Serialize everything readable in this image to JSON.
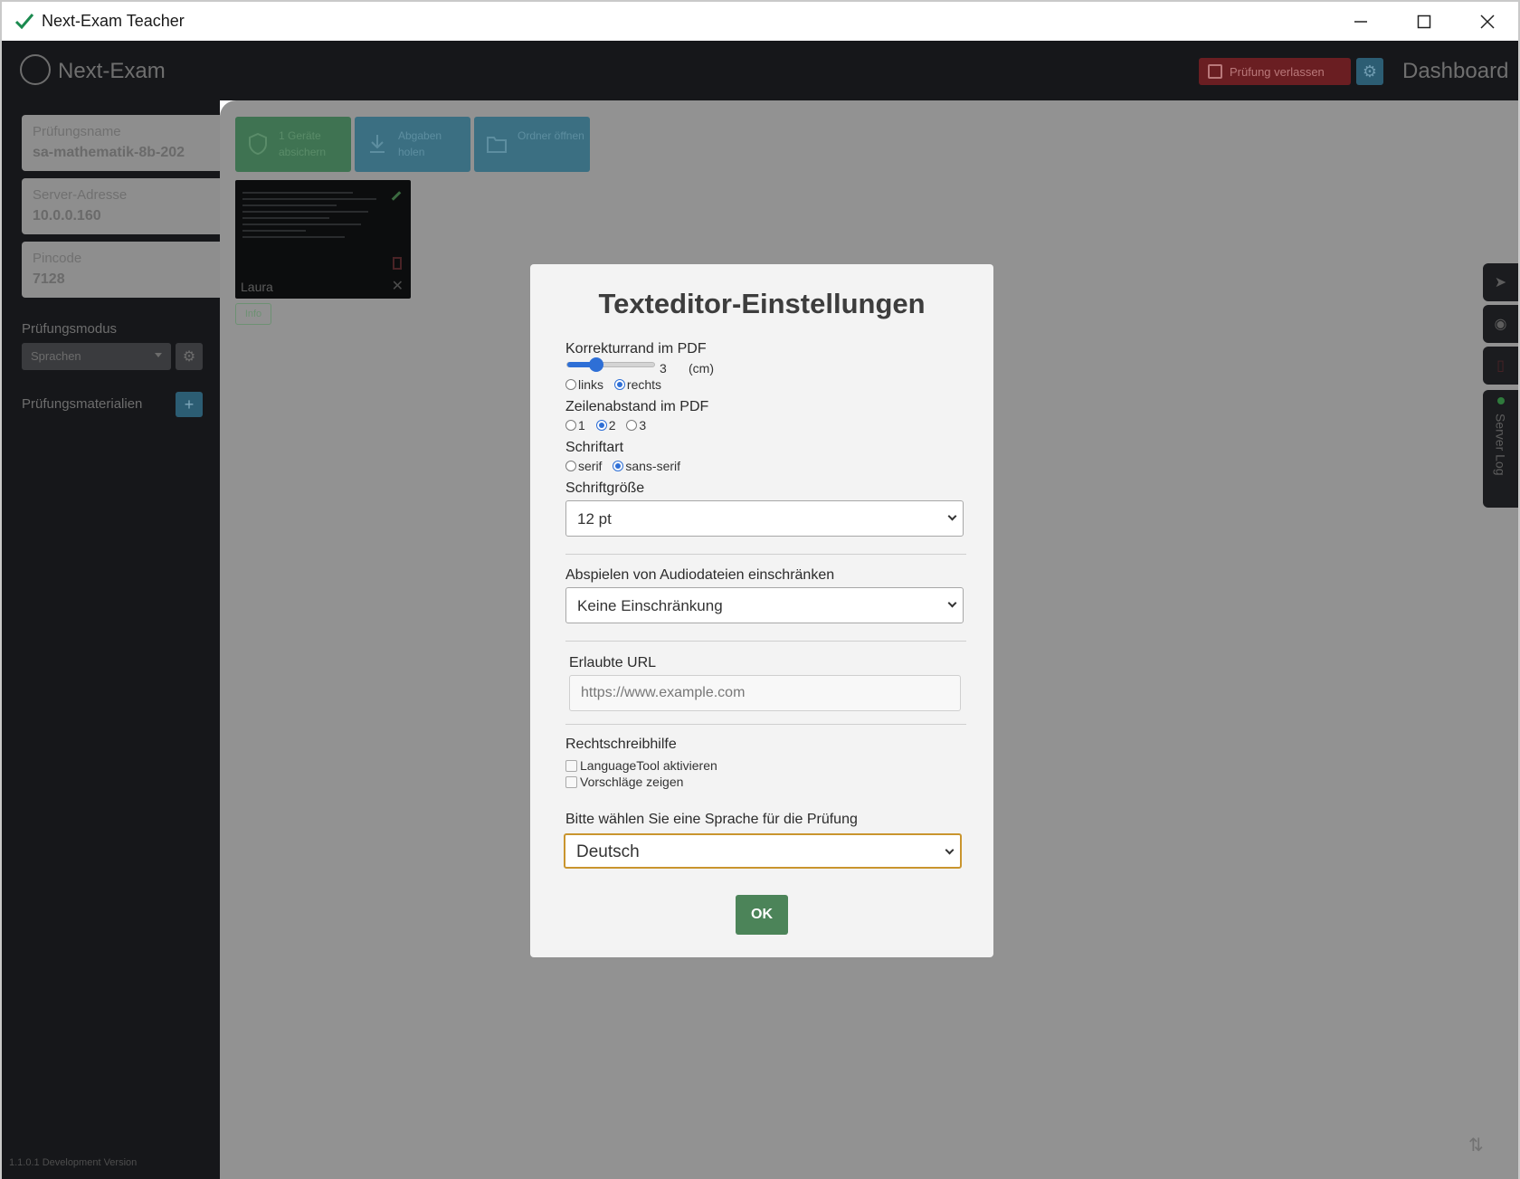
{
  "window": {
    "title": "Next-Exam Teacher"
  },
  "header": {
    "logo_text": "Next-Exam",
    "leave_button": "Prüfung verlassen",
    "dashboard_label": "Dashboard"
  },
  "sidebar": {
    "exam_name_label": "Prüfungsname",
    "exam_name_value": "sa-mathematik-8b-202",
    "server_label": "Server-Adresse",
    "server_value": "10.0.0.160",
    "pin_label": "Pincode",
    "pin_value": "7128",
    "mode_label": "Prüfungsmodus",
    "mode_value": "Sprachen",
    "materials_label": "Prüfungsmaterialien",
    "version": "1.1.0.1 Development Version"
  },
  "toolbar": {
    "lock_button": "1 Geräte absichern",
    "collect_button": "Abgaben holen",
    "folder_button": "Ordner öffnen"
  },
  "student": {
    "name": "Laura",
    "info_label": "Info"
  },
  "right_tabs": {
    "log_label": "Server Log"
  },
  "modal": {
    "title": "Texteditor-Einstellungen",
    "margin_label": "Korrekturrand im PDF",
    "margin_value": "3",
    "margin_unit": "(cm)",
    "margin_fraction": 0.33,
    "side_left": "links",
    "side_right": "rechts",
    "line_spacing_label": "Zeilenabstand im PDF",
    "line_spacing_options": [
      "1",
      "2",
      "3"
    ],
    "font_label": "Schriftart",
    "font_serif": "serif",
    "font_sans": "sans-serif",
    "font_size_label": "Schriftgröße",
    "font_size_value": "12 pt",
    "audio_label": "Abspielen von Audiodateien einschränken",
    "audio_value": "Keine Einschränkung",
    "url_label": "Erlaubte URL",
    "url_placeholder": "https://www.example.com",
    "spell_label": "Rechtschreibhilfe",
    "languagetool_label": "LanguageTool aktivieren",
    "suggestions_label": "Vorschläge zeigen",
    "language_label": "Bitte wählen Sie eine Sprache für die Prüfung",
    "language_value": "Deutsch",
    "ok_button": "OK"
  },
  "colors": {
    "accent_blue": "#2e6fd6",
    "ok_green": "#4c8459",
    "focus_border": "#c9952e"
  }
}
